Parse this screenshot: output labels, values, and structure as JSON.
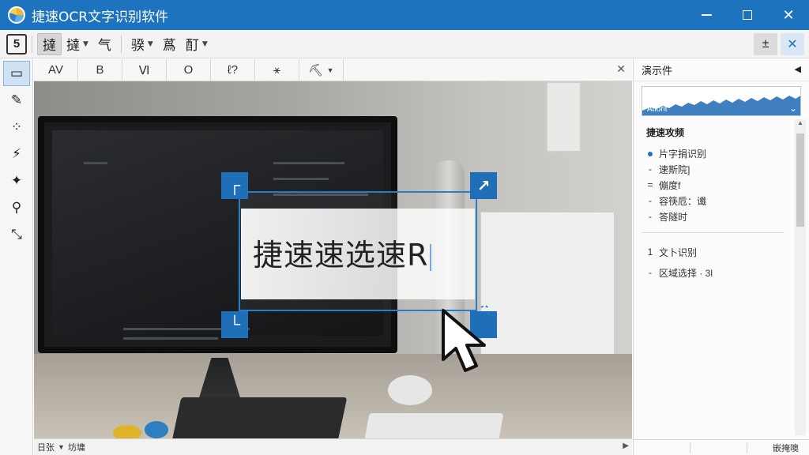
{
  "window": {
    "title": "捷速OCR文字识别软件",
    "icon": "app-logo-icon",
    "controls": {
      "minimize": "minimize-icon",
      "maximize": "maximize-icon",
      "close": "✕"
    }
  },
  "toolbar": {
    "logo": "5",
    "items": [
      {
        "label": "撻",
        "has_caret": false,
        "active": true
      },
      {
        "label": "撻",
        "has_caret": true,
        "active": false
      },
      {
        "label": "气",
        "has_caret": false,
        "active": false
      },
      {
        "label": "骙",
        "has_caret": true,
        "active": false
      },
      {
        "label": "蔿",
        "has_caret": false,
        "active": false
      },
      {
        "label": "酊",
        "has_caret": true,
        "active": false
      }
    ],
    "right_buttons": [
      "±",
      "✕"
    ]
  },
  "subbar": {
    "buttons": [
      "AV",
      "B",
      "Ⅵ",
      "O",
      "ℓ?",
      "⚹",
      "⛏"
    ],
    "last_has_caret": true,
    "close": "✕"
  },
  "left_tools": [
    "▭",
    "✎",
    "⁘",
    "⚡",
    "✦",
    "⚲",
    "⤡"
  ],
  "selection": {
    "recognized_text": "捷速速选速R",
    "handles": [
      "┌",
      "↗",
      "└",
      "✕"
    ]
  },
  "statusbar": {
    "left_label": "日张",
    "left_value": "坊墉",
    "scroll_arrow": "▶"
  },
  "right_panel": {
    "title": "演示件",
    "collapse": "◀",
    "preview_label": "Ationt",
    "preview_arrow": "⌄",
    "section1": {
      "title": "捷速攻频",
      "items": [
        {
          "bullet": "dot",
          "text": "片字捐识别"
        },
        {
          "bullet": "-",
          "text": "速斯院]"
        },
        {
          "bullet": "=",
          "text": "傰度f"
        },
        {
          "bullet": "-",
          "text": "容筷卮：谶"
        },
        {
          "bullet": "-",
          "text": "答隧时"
        }
      ]
    },
    "section2": {
      "items": [
        {
          "bullet": "1",
          "text": "文卜识别"
        },
        {
          "bullet": "-",
          "text": "区域选择 · 3l"
        }
      ]
    },
    "bottom_label": "嵌掩噢"
  },
  "colors": {
    "titlebar": "#1e73be",
    "accent": "#2a7cc7",
    "handle": "#1f6fb8"
  }
}
